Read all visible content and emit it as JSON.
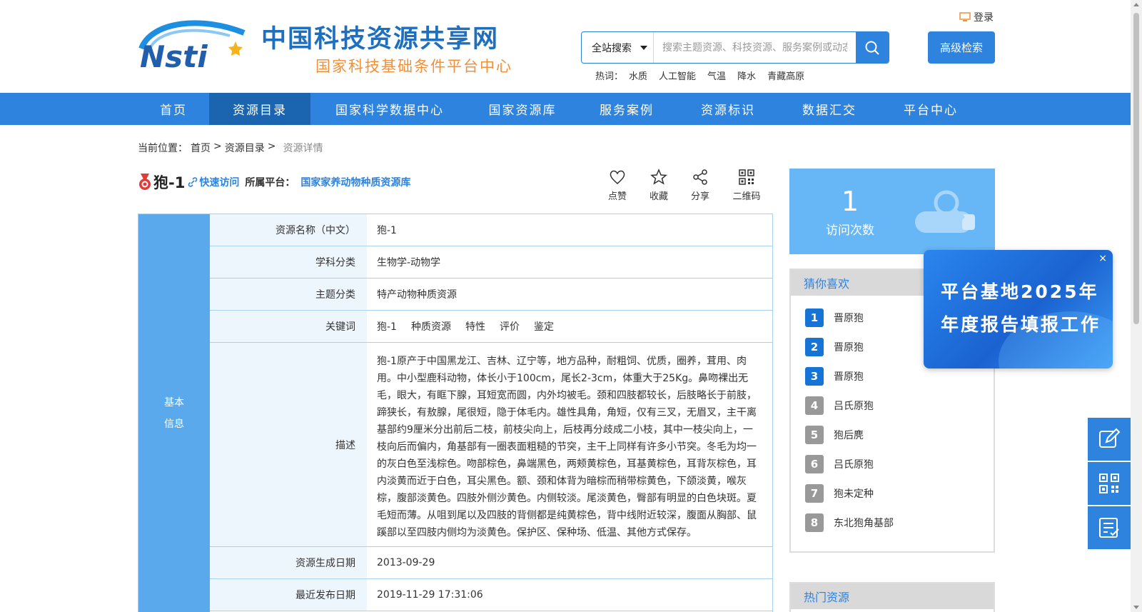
{
  "header": {
    "site_title": "中国科技资源共享网",
    "site_subtitle": "国家科技基础条件平台中心",
    "login_label": "登录",
    "search_scope": "全站搜索",
    "search_placeholder": "搜索主题资源、科技资源、服务案例或动态信息",
    "advanced_search_label": "高级检索",
    "hotwords_label": "热词：",
    "hotwords": [
      "水质",
      "人工智能",
      "气温",
      "降水",
      "青藏高原"
    ]
  },
  "nav": {
    "items": [
      "首页",
      "资源目录",
      "国家科学数据中心",
      "国家资源库",
      "服务案例",
      "资源标识",
      "数据汇交",
      "平台中心"
    ],
    "active_index": 1
  },
  "breadcrumb": {
    "label": "当前位置：",
    "home": "首页",
    "sep1": ">",
    "catalog": "资源目录",
    "sep2": ">",
    "current": "资源详情"
  },
  "resource": {
    "title": "狍-1",
    "quick_access": "快速访问",
    "platform_label": "所属平台：",
    "platform_value": "国家家养动物种质资源库"
  },
  "actions": {
    "like": "点赞",
    "favorite": "收藏",
    "share": "分享",
    "qrcode": "二维码"
  },
  "info": {
    "section_label": "基本信息",
    "name_label": "资源名称（中文）",
    "name_value": "狍-1",
    "subject_label": "学科分类",
    "subject_value": "生物学-动物学",
    "topic_label": "主题分类",
    "topic_value": "特产动物种质资源",
    "keywords_label": "关键词",
    "keywords": [
      "狍-1",
      "种质资源",
      "特性",
      "评价",
      "鉴定"
    ],
    "description_label": "描述",
    "description_value": "狍-1原产于中国黑龙江、吉林、辽宁等，地方品种，耐粗饲、优质，圈养，茸用、肉用。中小型鹿科动物，体长小于100cm，尾长2-3cm，体重大于25Kg。鼻吻裸出无毛，眼大，有眶下腺，耳短宽而圆，内外均被毛。颈和四肢都较长，后肢略长于前肢，蹄狭长，有敖腺，尾很短，隐于体毛内。雄性具角，角短，仅有三叉，无眉叉，主干离基部约9厘米分出前后二枝，前枝尖向上，后枝再分歧成二小枝，其中一枝尖向上，一枝向后而偏内，角基部有一圈表面粗糙的节突，主干上同样有许多小节突。冬毛为均一的灰白色至浅棕色。吻部棕色，鼻端黑色，两颊黄棕色，耳基黄棕色，耳背灰棕色，耳内淡黄而近于白色，耳尖黑色。额、颈和体背为暗棕而稍带棕黄色，下颌淡黄，喉灰棕，腹部淡黄色。四肢外侧沙黄色。内侧较淡。尾淡黄色，臀部有明显的白色块斑。夏毛短而薄。从咀到尾以及四肢的背侧都是纯黄棕色，背中线附近较深，腹面从胸部、鼠蹊部以至四肢内侧均为淡黄色。保护区、保种场、低温、其他方式保存。",
    "created_label": "资源生成日期",
    "created_value": "2013-09-29",
    "published_label": "最近发布日期",
    "published_value": "2019-11-29 17:31:06"
  },
  "visit": {
    "count": "1",
    "label": "访问次数"
  },
  "guess": {
    "title": "猜你喜欢",
    "items": [
      {
        "num": "1",
        "name": "晋原狍"
      },
      {
        "num": "2",
        "name": "晋原狍"
      },
      {
        "num": "3",
        "name": "晋原狍"
      },
      {
        "num": "4",
        "name": "吕氏原狍"
      },
      {
        "num": "5",
        "name": "狍后麂"
      },
      {
        "num": "6",
        "name": "吕氏原狍"
      },
      {
        "num": "7",
        "name": "狍未定种"
      },
      {
        "num": "8",
        "name": "东北狍角基部"
      }
    ]
  },
  "hot": {
    "title": "热门资源"
  },
  "popup": {
    "text": "平台基地2025年年度报告填报工作",
    "close": "×"
  },
  "colors": {
    "brand_blue": "#2d83de",
    "nav_active": "#1a64b0",
    "subtitle_orange": "#f0913a",
    "side_blue": "#5aa9ec",
    "top_rank": "#1674d6"
  }
}
